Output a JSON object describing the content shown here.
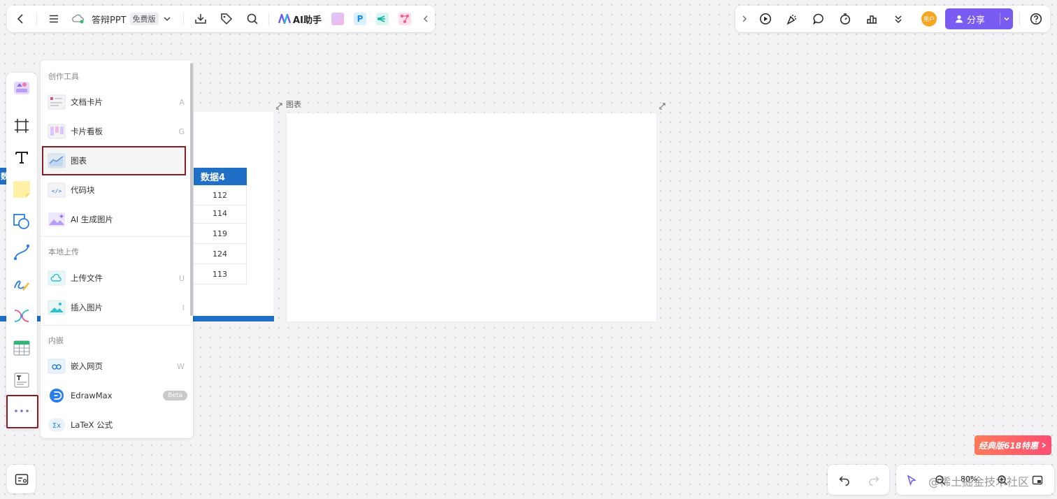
{
  "toolbar_left": {
    "doc_title": "答辩PPT",
    "plan_badge": "免费版",
    "ai_label": "AI助手",
    "icons": [
      "back-icon",
      "menu-icon",
      "cloud-sync-icon",
      "chevron-down-icon",
      "download-icon",
      "tag-icon",
      "search-icon",
      "ai-logo-icon",
      "ai-image-icon",
      "p-app-icon",
      "mindmap-app-icon",
      "flow-app-icon",
      "collapse-left-icon"
    ]
  },
  "toolbar_right": {
    "avatar_text": "用户",
    "share_label": "分享",
    "icons": [
      "expand-right-icon",
      "play-icon",
      "celebrate-icon",
      "comment-icon",
      "timer-icon",
      "podium-icon",
      "more-down-icon",
      "user-icon",
      "caret-down-icon",
      "help-icon"
    ]
  },
  "left_toolbar": {
    "tools": [
      "template-icon",
      "frame-icon",
      "text-icon",
      "sticky-note-icon",
      "shape-icon",
      "connector-icon",
      "pen-icon",
      "mindmap-icon",
      "table-icon",
      "text-card-icon",
      "more-icon"
    ]
  },
  "insert_menu": {
    "sections": [
      {
        "title": "创作工具",
        "items": [
          {
            "label": "文档卡片",
            "key": "A"
          },
          {
            "label": "卡片看板",
            "key": "G"
          },
          {
            "label": "图表",
            "key": ""
          },
          {
            "label": "代码块",
            "key": ""
          },
          {
            "label": "AI 生成图片",
            "key": ""
          }
        ]
      },
      {
        "title": "本地上传",
        "items": [
          {
            "label": "上传文件",
            "key": "U"
          },
          {
            "label": "插入图片",
            "key": "I"
          }
        ]
      },
      {
        "title": "内嵌",
        "items": [
          {
            "label": "嵌入网页",
            "key": "W"
          },
          {
            "label": "EdrawMax",
            "badge": "Beta"
          },
          {
            "label": "LaTeX 公式",
            "key": ""
          }
        ]
      }
    ]
  },
  "canvas": {
    "table": {
      "header": "数据4",
      "left_stub": "数",
      "values": [
        "112",
        "114",
        "119",
        "124",
        "113"
      ]
    },
    "chart_frame_label": "图表"
  },
  "bottom": {
    "zoom_level": "80%",
    "promo_text": "经典版618特惠",
    "watermark": "@稀土掘金技术社区"
  },
  "colors": {
    "accent": "#7b5cf2",
    "table_blue": "#1e6fc5",
    "highlight_border": "#8b1c24",
    "promo_start": "#ff7a59",
    "promo_end": "#ff4e73"
  }
}
